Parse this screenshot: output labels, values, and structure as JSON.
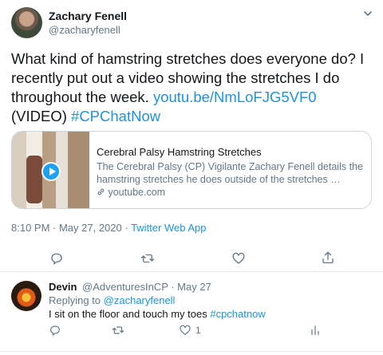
{
  "tweet": {
    "author_name": "Zachary Fenell",
    "author_handle": "@zacharyfenell",
    "text_main": "What kind of hamstring stretches does everyone do? I recently put out a video showing the stretches I do throughout the week. ",
    "link_text": "youtu.be/NmLoFJG5VF0",
    "text_after": " (VIDEO) ",
    "hashtag": "#CPChatNow",
    "card": {
      "title": "Cerebral Palsy Hamstring Stretches",
      "description": "The Cerebral Palsy (CP) Vigilante Zachary Fenell details the hamstring stretches he does outside of the stretches …",
      "domain": "youtube.com"
    },
    "timestamp": "8:10 PM · May 27, 2020 · ",
    "source": "Twitter Web App",
    "actions": [
      "reply-icon",
      "retweet-icon",
      "like-icon",
      "share-icon"
    ]
  },
  "reply": {
    "author_name": "Devin",
    "author_handle": "@AdventuresInCP · May 27",
    "replying_prefix": "Replying to ",
    "replying_handle": "@zacharyfenell",
    "text": "I sit on the floor and touch my toes ",
    "hashtag": "#cpchatnow",
    "like_count": "1",
    "actions": [
      "reply-icon",
      "retweet-icon",
      "like-icon",
      "analytics-icon"
    ]
  },
  "colors": {
    "link": "#1b95e0",
    "muted": "#657786",
    "text": "#14171a",
    "border": "#ccd6dd"
  }
}
